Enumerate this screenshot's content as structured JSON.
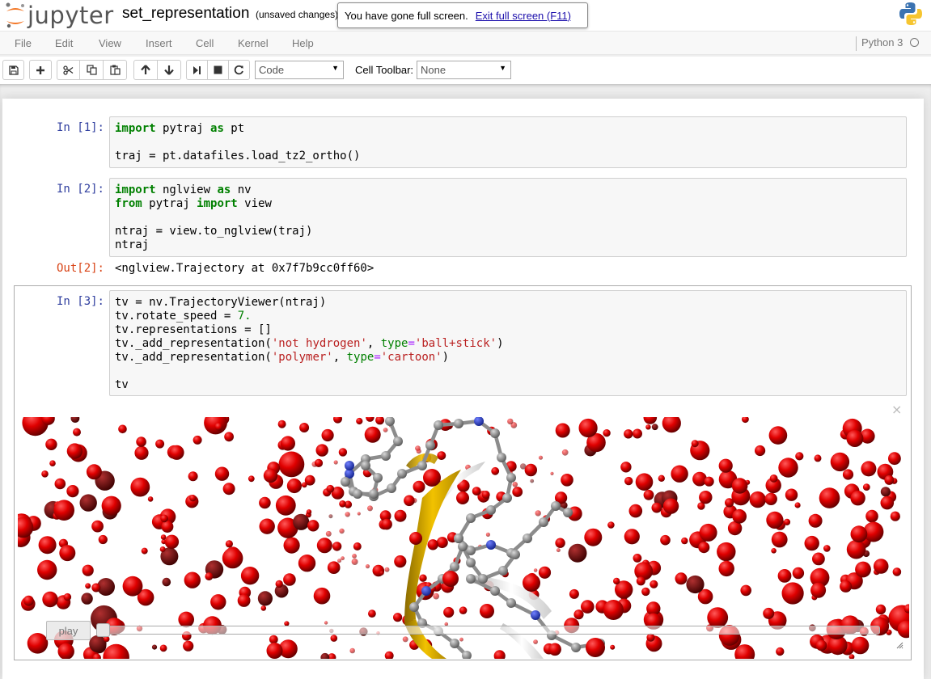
{
  "header": {
    "logo_text": "jupyter",
    "notebook_name": "set_representation",
    "save_status": "(unsaved changes)",
    "fullscreen_message": "You have gone full screen.",
    "fullscreen_exit": "Exit full screen (F11)"
  },
  "menubar": {
    "items": [
      "File",
      "Edit",
      "View",
      "Insert",
      "Cell",
      "Kernel",
      "Help"
    ],
    "kernel_name": "Python 3"
  },
  "toolbar": {
    "buttons": [
      "save-icon",
      "plus-icon",
      "cut-icon",
      "copy-icon",
      "paste-icon",
      "arrow-up-icon",
      "arrow-down-icon",
      "step-forward-icon",
      "stop-icon",
      "restart-icon"
    ],
    "cell_type": "Code",
    "cell_toolbar_label": "Cell Toolbar:",
    "cell_toolbar_value": "None"
  },
  "cells": {
    "c1": {
      "prompt": "In [1]:",
      "lines": [
        "import pytraj as pt",
        "",
        "traj = pt.datafiles.load_tz2_ortho()"
      ]
    },
    "c2": {
      "prompt": "In [2]:",
      "lines": [
        "import nglview as nv",
        "from pytraj import view",
        "",
        "ntraj = view.to_nglview(traj)",
        "ntraj"
      ],
      "out_prompt": "Out[2]:",
      "output": "<nglview.Trajectory at 0x7f7b9cc0ff60>"
    },
    "c3": {
      "prompt": "In [3]:",
      "lines": [
        "tv = nv.TrajectoryViewer(ntraj)",
        "tv.rotate_speed = 7.",
        "tv.representations = []",
        "tv._add_representation('not hydrogen', type='ball+stick')",
        "tv._add_representation('polymer', type='cartoon')",
        "",
        "tv"
      ]
    }
  },
  "widget": {
    "play_label": "play",
    "close_glyph": "×",
    "frame_position": 0.0
  },
  "colors": {
    "prompt_in": "#303f9f",
    "prompt_out": "#d84315",
    "keyword": "#008000",
    "string": "#ba2121",
    "water_oxygen": "#e00000",
    "ribbon": "#e8b400",
    "carbon": "#8c8c8c",
    "nitrogen": "#2a3fd0"
  }
}
